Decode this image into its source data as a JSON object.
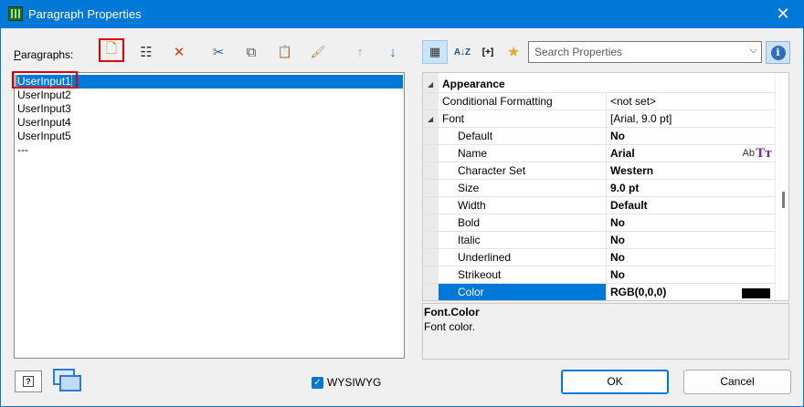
{
  "window": {
    "title": "Paragraph Properties",
    "close_label": "✕"
  },
  "left": {
    "label": "Paragraphs:",
    "label_mnemonic": "P",
    "label_rest": "aragraphs:",
    "toolbar": {
      "new_icon": "🗋",
      "properties_icon": "☷",
      "delete_icon": "✕",
      "cut_icon": "✂",
      "copy_icon": "⧉",
      "paste_icon": "📋",
      "format_icon": "🖌",
      "up_icon": "↑",
      "down_icon": "↓"
    },
    "items": [
      {
        "label": "UserInput1",
        "selected": true
      },
      {
        "label": "UserInput2"
      },
      {
        "label": "UserInput3"
      },
      {
        "label": "UserInput4"
      },
      {
        "label": "UserInput5"
      },
      {
        "label": "---"
      }
    ]
  },
  "right": {
    "toolbar": {
      "categorized_icon": "▦",
      "sort_icon": "A↓Z",
      "expand_icon": "[+]",
      "favorite_icon": "★"
    },
    "search": {
      "placeholder": "Search Properties",
      "dropdown_icon": "⌵"
    },
    "info_label": "i",
    "grid": {
      "category": {
        "name": "Appearance",
        "toggle": "◢"
      },
      "rows": [
        {
          "name": "Conditional Formatting",
          "value": "<not set>",
          "bold": false
        },
        {
          "name": "Font",
          "value": "[Arial, 9.0 pt]",
          "bold": false,
          "toggle": "◢"
        },
        {
          "name": "Default",
          "value": "No",
          "bold": true
        },
        {
          "name": "Name",
          "value": "Arial",
          "bold": true,
          "extra_ab": "Ab",
          "extra_tt": "Tт"
        },
        {
          "name": "Character Set",
          "value": "Western",
          "bold": true
        },
        {
          "name": "Size",
          "value": "9.0 pt",
          "bold": true
        },
        {
          "name": "Width",
          "value": "Default",
          "bold": true
        },
        {
          "name": "Bold",
          "value": "No",
          "bold": true
        },
        {
          "name": "Italic",
          "value": "No",
          "bold": true
        },
        {
          "name": "Underlined",
          "value": "No",
          "bold": true
        },
        {
          "name": "Strikeout",
          "value": "No",
          "bold": true
        },
        {
          "name": "Color",
          "value": "RGB(0,0,0)",
          "bold": true,
          "selected": true,
          "swatch": "#000000"
        }
      ]
    },
    "description": {
      "title": "Font.Color",
      "text": "Font color."
    }
  },
  "footer": {
    "help_icon": "?",
    "wysiwyg_label": "WYSIWYG",
    "wysiwyg_checked": true,
    "check_icon": "✓",
    "ok_label": "OK",
    "cancel_label": "Cancel"
  },
  "colors": {
    "accent": "#0078d7",
    "highlight_red": "#e00000"
  }
}
